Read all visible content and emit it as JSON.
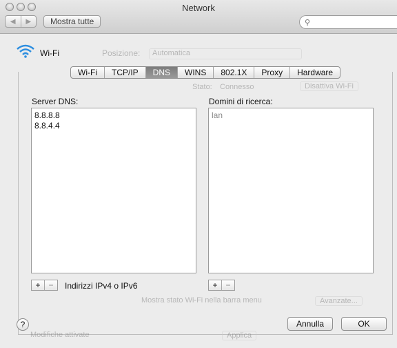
{
  "window": {
    "title": "Network"
  },
  "toolbar": {
    "back_icon": "chevron-left-icon",
    "forward_icon": "chevron-right-icon",
    "show_all_label": "Mostra tutte",
    "search_placeholder": ""
  },
  "background": {
    "service_label": "Wi-Fi",
    "service_icon": "wifi-icon",
    "location_label": "Posizione:",
    "location_value": "Automatica",
    "status_label": "Stato:",
    "status_value": "Connesso",
    "turn_off_label": "Disattiva Wi-Fi",
    "menu_checkbox_label": "Mostra stato Wi-Fi nella barra menu",
    "advanced_label": "Avanzate...",
    "apply_label": "Applica",
    "modifications_label": "Modifiche attivate"
  },
  "tabs": [
    "Wi-Fi",
    "TCP/IP",
    "DNS",
    "WINS",
    "802.1X",
    "Proxy",
    "Hardware"
  ],
  "active_tab": "DNS",
  "dns": {
    "servers_label": "Server DNS:",
    "servers": [
      "8.8.8.8",
      "8.8.4.4"
    ],
    "servers_hint": "Indirizzi IPv4 o IPv6",
    "search_domains_label": "Domini di ricerca:",
    "search_domains": [
      "lan"
    ]
  },
  "controls": {
    "add_symbol": "+",
    "remove_symbol": "−"
  },
  "footer": {
    "help_symbol": "?",
    "cancel_label": "Annulla",
    "ok_label": "OK"
  },
  "colors": {
    "window_bg": "#ececec",
    "active_tab": "#8a8a8a",
    "wifi_blue": "#2d8ee0"
  }
}
